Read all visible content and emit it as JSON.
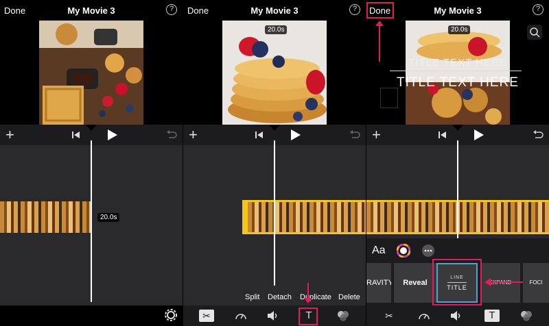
{
  "header": {
    "done_label": "Done",
    "project_title": "My Movie 3",
    "help_label": "?"
  },
  "panel1": {
    "duration_badge": "20.0s"
  },
  "panel2": {
    "duration_badge": "20.0s",
    "actions": [
      "Split",
      "Detach",
      "Duplicate",
      "Delete"
    ]
  },
  "panel3": {
    "duration_badge": "20.0s",
    "overlay_title_top": "TITLE TEXT HERE",
    "overlay_title_bottom": "TITLE TEXT HERE",
    "font_label": "Aa",
    "title_styles": [
      {
        "label": "RAVITY"
      },
      {
        "label": "Reveal"
      },
      {
        "label_top": "LINE",
        "label_bottom": "TITLE"
      },
      {
        "label": "EXPAND"
      },
      {
        "label": "FOCI"
      }
    ]
  },
  "colors": {
    "highlight": "#e6195a",
    "clip_selected": "#f5c518",
    "selected_tile_border": "#4fa3d1"
  },
  "icons": [
    "plus-icon",
    "skip-back-icon",
    "play-icon",
    "undo-icon",
    "gear-icon",
    "scissors-icon",
    "speed-icon",
    "volume-icon",
    "text-icon",
    "filter-icon",
    "zoom-icon",
    "color-wheel-icon",
    "more-icon"
  ]
}
